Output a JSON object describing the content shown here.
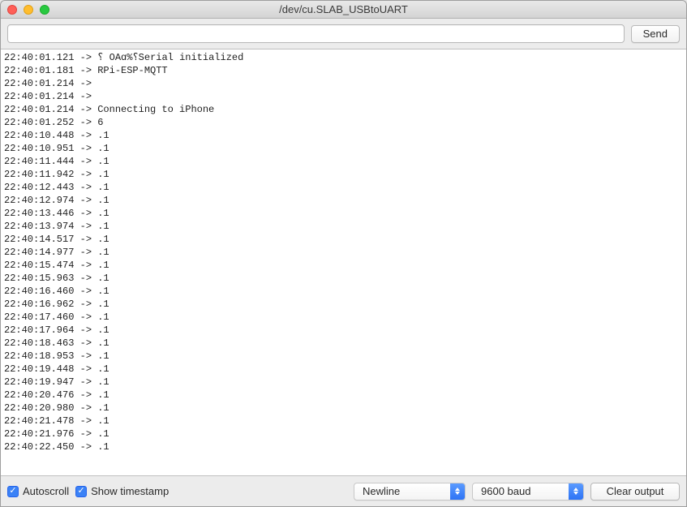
{
  "window": {
    "title": "/dev/cu.SLAB_USBtoUART"
  },
  "toolbar": {
    "input_value": "",
    "input_placeholder": "",
    "send_label": "Send"
  },
  "console_lines": [
    "22:40:01.121 -> ⸮ OAɑ%⸮Serial initialized",
    "22:40:01.181 -> RPi-ESP-MQTT",
    "22:40:01.214 -> ",
    "22:40:01.214 -> ",
    "22:40:01.214 -> Connecting to iPhone",
    "22:40:01.252 -> 6",
    "22:40:10.448 -> .1",
    "22:40:10.951 -> .1",
    "22:40:11.444 -> .1",
    "22:40:11.942 -> .1",
    "22:40:12.443 -> .1",
    "22:40:12.974 -> .1",
    "22:40:13.446 -> .1",
    "22:40:13.974 -> .1",
    "22:40:14.517 -> .1",
    "22:40:14.977 -> .1",
    "22:40:15.474 -> .1",
    "22:40:15.963 -> .1",
    "22:40:16.460 -> .1",
    "22:40:16.962 -> .1",
    "22:40:17.460 -> .1",
    "22:40:17.964 -> .1",
    "22:40:18.463 -> .1",
    "22:40:18.953 -> .1",
    "22:40:19.448 -> .1",
    "22:40:19.947 -> .1",
    "22:40:20.476 -> .1",
    "22:40:20.980 -> .1",
    "22:40:21.478 -> .1",
    "22:40:21.976 -> .1",
    "22:40:22.450 -> .1"
  ],
  "footer": {
    "autoscroll_label": "Autoscroll",
    "show_timestamp_label": "Show timestamp",
    "line_ending_selected": "Newline",
    "baud_selected": "9600 baud",
    "clear_label": "Clear output"
  }
}
